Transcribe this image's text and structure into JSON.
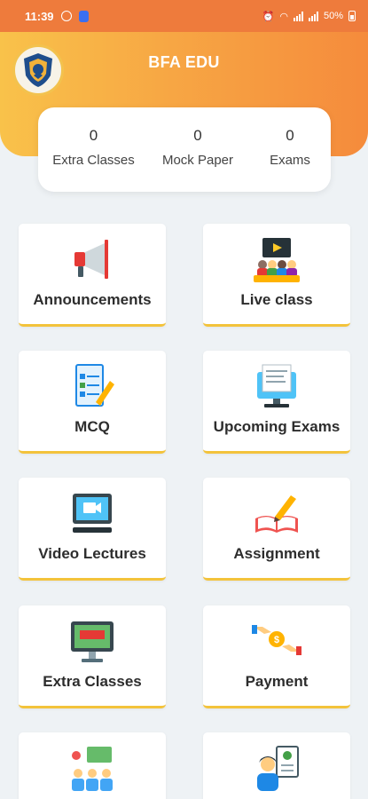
{
  "status_bar": {
    "time": "11:39",
    "battery": "50%"
  },
  "header": {
    "title": "BFA EDU"
  },
  "stats": [
    {
      "value": "0",
      "label": "Extra Classes"
    },
    {
      "value": "0",
      "label": "Mock Paper"
    },
    {
      "value": "0",
      "label": "Exams"
    }
  ],
  "tiles": [
    {
      "label": "Announcements",
      "icon": "megaphone-icon"
    },
    {
      "label": "Live class",
      "icon": "live-class-icon"
    },
    {
      "label": "MCQ",
      "icon": "mcq-icon"
    },
    {
      "label": "Upcoming Exams",
      "icon": "monitor-exam-icon"
    },
    {
      "label": "Video Lectures",
      "icon": "video-lecture-icon"
    },
    {
      "label": "Assignment",
      "icon": "book-pencil-icon"
    },
    {
      "label": "Extra Classes",
      "icon": "classroom-monitor-icon"
    },
    {
      "label": "Payment",
      "icon": "payment-hand-icon"
    },
    {
      "label": "",
      "icon": "group-students-icon"
    },
    {
      "label": "",
      "icon": "checklist-person-icon"
    }
  ],
  "colors": {
    "header_start": "#f9c24a",
    "header_end": "#f58b3c",
    "tile_accent": "#f3c33b",
    "background": "#eef2f5"
  }
}
